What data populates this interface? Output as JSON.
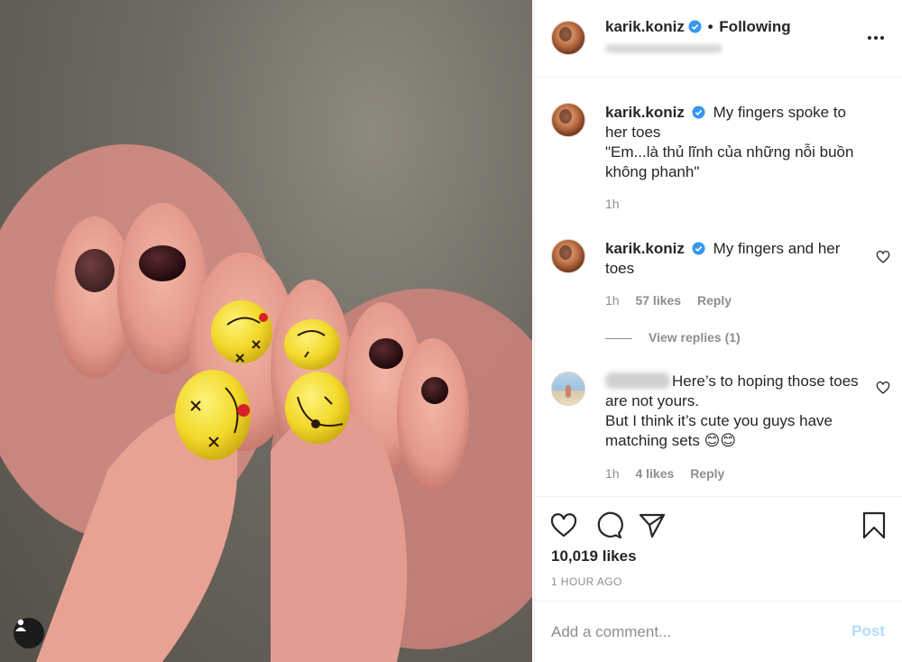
{
  "post": {
    "username": "karik.koniz",
    "follow_label": "Following",
    "separator": "•"
  },
  "comments": [
    {
      "username": "karik.koniz",
      "lines": [
        "My fingers spoke to her toes",
        "\"Em...là thủ lĩnh của những nỗi buồn không phanh\""
      ],
      "time": "1h"
    },
    {
      "username": "karik.koniz",
      "text": "My fingers and her toes",
      "time": "1h",
      "likes": "57 likes",
      "reply": "Reply",
      "view_replies": "View replies (1)"
    },
    {
      "lines": [
        "Here’s to hoping those toes are not yours.",
        "But I think it’s cute you guys have matching sets 😊😊"
      ],
      "time": "1h",
      "likes": "4 likes",
      "reply": "Reply"
    }
  ],
  "footer": {
    "likes": "10,019 likes",
    "time": "1 HOUR AGO",
    "comment_placeholder": "Add a comment...",
    "post_label": "Post"
  },
  "icons": {
    "more": "more-options-icon",
    "verified": "verified-badge-icon",
    "heart": "heart-icon",
    "comment": "comment-icon",
    "share": "share-icon",
    "save": "bookmark-icon",
    "tag": "user-tag-icon"
  },
  "colors": {
    "verified": "#3897f0",
    "post_disabled": "#b3dbff",
    "nail_yellow": "#f2d92a",
    "nail_dark": "#2a0f12"
  }
}
